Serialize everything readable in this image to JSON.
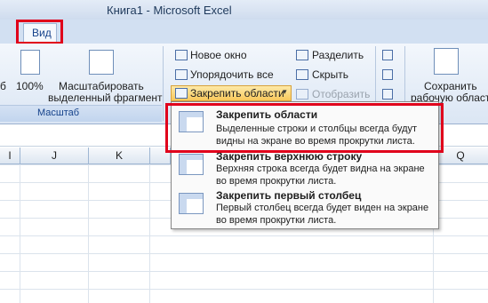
{
  "window": {
    "title": "Книга1 - Microsoft Excel"
  },
  "tabs": {
    "active": "Вид"
  },
  "ribbon": {
    "left_small": "б",
    "zoom100": "100%",
    "fit_selection": [
      "Масштабировать",
      "выделенный фрагмент"
    ],
    "group_name": "Масштаб",
    "new_window": "Новое окно",
    "arrange_all": "Упорядочить все",
    "freeze_panes": "Закрепить области",
    "split": "Разделить",
    "hide": "Скрыть",
    "unhide": "Отобразить",
    "save_workspace": [
      "Сохранить",
      "рабочую область"
    ]
  },
  "columns": [
    "I",
    "J",
    "K",
    "Q"
  ],
  "freeze_menu": {
    "items": [
      {
        "title": "Закрепить области",
        "desc": "Выделенные строки и столбцы всегда будут видны на экране во время прокрутки листа."
      },
      {
        "title": "Закрепить верхнюю строку",
        "desc": "Верхняя строка всегда будет видна на экране во время прокрутки листа."
      },
      {
        "title": "Закрепить первый столбец",
        "desc": "Первый столбец всегда будет виден на экране во время прокрутки листа."
      }
    ]
  },
  "colors": {
    "highlight": "#e0001b",
    "ribbon_text": "#15428b"
  }
}
